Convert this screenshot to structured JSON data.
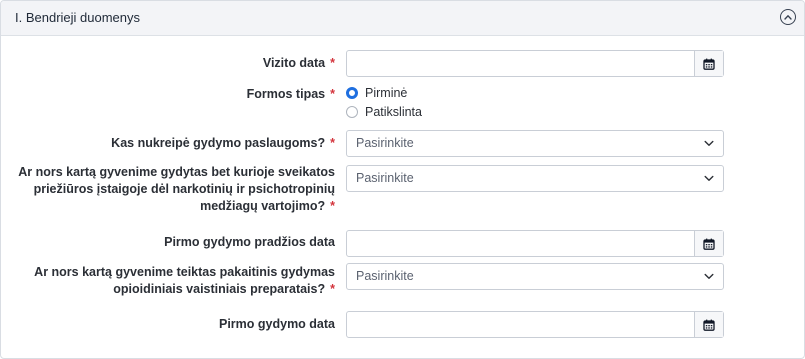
{
  "panel": {
    "title": "I. Bendrieji duomenys",
    "collapse_icon": "chevron-up-circle-icon"
  },
  "fields": {
    "vizito_data": {
      "label": "Vizito data",
      "required_mark": "*",
      "value": "",
      "icon": "calendar-icon"
    },
    "formos_tipas": {
      "label": "Formos tipas",
      "required_mark": "*",
      "options": [
        {
          "label": "Pirminė",
          "selected": true
        },
        {
          "label": "Patikslinta",
          "selected": false
        }
      ]
    },
    "kas_nukreipe": {
      "label": "Kas nukreipė gydymo paslaugoms?",
      "required_mark": "*",
      "value": "Pasirinkite"
    },
    "ar_gydytas": {
      "label_lines": [
        "Ar nors kartą gyvenime gydytas bet kurioje sveikatos",
        "priežiūros įstaigoje dėl narkotinių ir psichotropinių",
        "medžiagų vartojimo?"
      ],
      "required_mark": "*",
      "value": "Pasirinkite"
    },
    "pirmo_gydymo_pradzios_data": {
      "label": "Pirmo gydymo pradžios data",
      "value": "",
      "icon": "calendar-icon"
    },
    "ar_teiktas_pakaitinis": {
      "label_lines": [
        "Ar nors kartą gyvenime teiktas pakaitinis gydymas",
        "opioidiniais vaistiniais preparatais?"
      ],
      "required_mark": "*",
      "value": "Pasirinkite"
    },
    "pirmo_gydymo_data": {
      "label": "Pirmo gydymo data",
      "value": "",
      "icon": "calendar-icon"
    }
  },
  "colors": {
    "required": "#d3343c",
    "radio_accent": "#1f6fe0",
    "header_bg": "#f3f4f7",
    "border": "#c9ced6"
  }
}
